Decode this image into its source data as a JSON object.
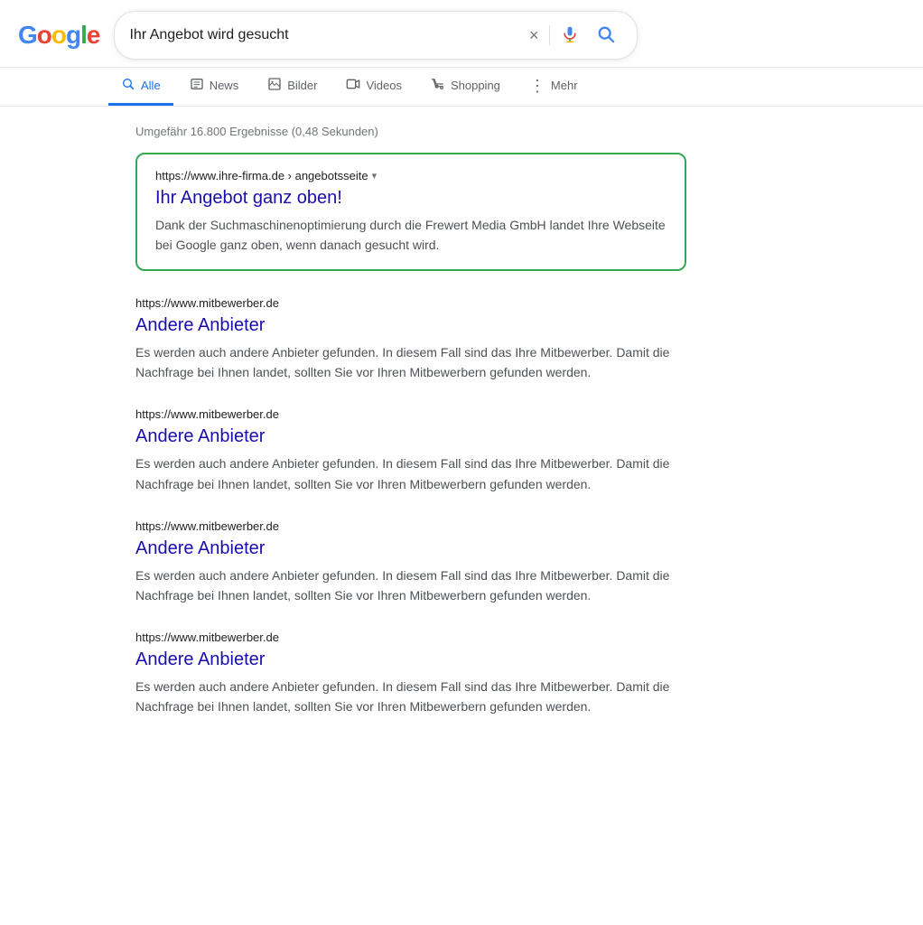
{
  "header": {
    "logo_letters": [
      {
        "letter": "G",
        "color": "blue"
      },
      {
        "letter": "o",
        "color": "red"
      },
      {
        "letter": "o",
        "color": "yellow"
      },
      {
        "letter": "g",
        "color": "blue"
      },
      {
        "letter": "l",
        "color": "green"
      },
      {
        "letter": "e",
        "color": "red"
      }
    ],
    "search_query": "Ihr Angebot wird gesucht",
    "clear_label": "×"
  },
  "nav": {
    "tabs": [
      {
        "id": "alle",
        "label": "Alle",
        "icon": "🔍",
        "active": true
      },
      {
        "id": "news",
        "label": "News",
        "icon": "📰",
        "active": false
      },
      {
        "id": "bilder",
        "label": "Bilder",
        "icon": "🖼",
        "active": false
      },
      {
        "id": "videos",
        "label": "Videos",
        "icon": "▶",
        "active": false
      },
      {
        "id": "shopping",
        "label": "Shopping",
        "icon": "🏷",
        "active": false
      },
      {
        "id": "mehr",
        "label": "Mehr",
        "icon": "⋮",
        "active": false
      }
    ]
  },
  "results": {
    "stats": "Umgefähr 16.800 Ergebnisse (0,48 Sekunden)",
    "featured": {
      "url": "https://www.ihre-firma.de › angebotsseite",
      "title": "Ihr Angebot ganz oben!",
      "description": "Dank der Suchmaschinenoptimierung durch die Frewert Media GmbH landet Ihre Webseite bei Google ganz oben, wenn danach gesucht wird."
    },
    "items": [
      {
        "url": "https://www.mitbewerber.de",
        "title": "Andere Anbieter",
        "description": "Es werden auch andere Anbieter gefunden. In diesem Fall sind das Ihre Mitbewerber. Damit die Nachfrage bei Ihnen landet, sollten Sie vor Ihren Mitbewerbern gefunden werden."
      },
      {
        "url": "https://www.mitbewerber.de",
        "title": "Andere Anbieter",
        "description": "Es werden auch andere Anbieter gefunden. In diesem Fall sind das Ihre Mitbewerber. Damit die Nachfrage bei Ihnen landet, sollten Sie vor Ihren Mitbewerbern gefunden werden."
      },
      {
        "url": "https://www.mitbewerber.de",
        "title": "Andere Anbieter",
        "description": "Es werden auch andere Anbieter gefunden. In diesem Fall sind das Ihre Mitbewerber. Damit die Nachfrage bei Ihnen landet, sollten Sie vor Ihren Mitbewerbern gefunden werden."
      },
      {
        "url": "https://www.mitbewerber.de",
        "title": "Andere Anbieter",
        "description": "Es werden auch andere Anbieter gefunden. In diesem Fall sind das Ihre Mitbewerber. Damit die Nachfrage bei Ihnen landet, sollten Sie vor Ihren Mitbewerbern gefunden werden."
      }
    ]
  }
}
